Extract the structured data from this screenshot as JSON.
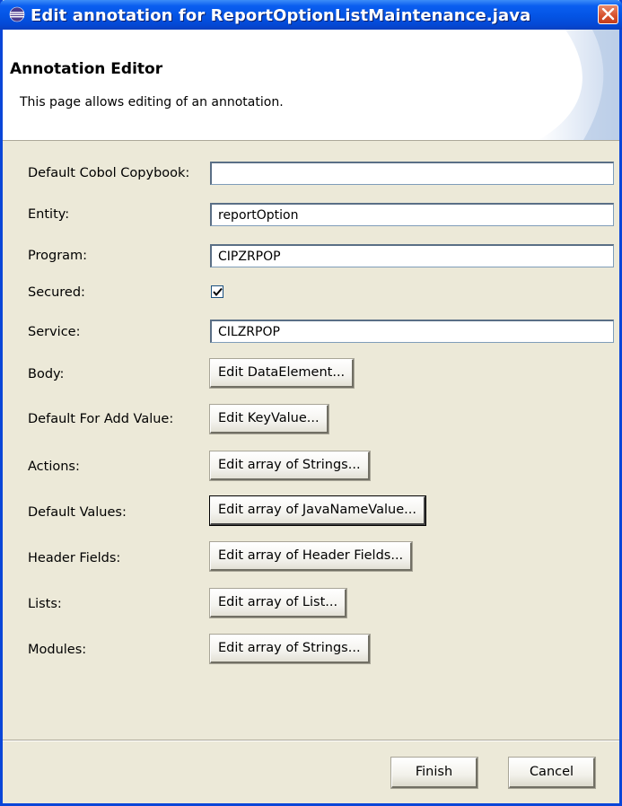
{
  "window": {
    "title": "Edit annotation for ReportOptionListMaintenance.java",
    "close_icon": "close-icon",
    "app_icon": "eclipse-icon"
  },
  "banner": {
    "title": "Annotation Editor",
    "description": "This page allows editing of an annotation."
  },
  "fields": {
    "default_cobol_copybook": {
      "label": "Default Cobol Copybook:",
      "value": ""
    },
    "entity": {
      "label": "Entity:",
      "value": "reportOption"
    },
    "program": {
      "label": "Program:",
      "value": "CIPZRPOP"
    },
    "secured": {
      "label": "Secured:",
      "checked": true
    },
    "service": {
      "label": "Service:",
      "value": "CILZRPOP"
    },
    "body": {
      "label": "Body:",
      "button": "Edit DataElement..."
    },
    "default_for_add_value": {
      "label": "Default For Add Value:",
      "button": "Edit KeyValue..."
    },
    "actions": {
      "label": "Actions:",
      "button": "Edit array of Strings..."
    },
    "default_values": {
      "label": "Default Values:",
      "button": "Edit array of JavaNameValue..."
    },
    "header_fields": {
      "label": "Header Fields:",
      "button": "Edit array of Header Fields..."
    },
    "lists": {
      "label": "Lists:",
      "button": "Edit array of List..."
    },
    "modules": {
      "label": "Modules:",
      "button": "Edit array of Strings..."
    }
  },
  "footer": {
    "finish_label": "Finish",
    "cancel_label": "Cancel"
  },
  "colors": {
    "titlebar": "#0454e4",
    "dialog_bg": "#ece9d8",
    "close_button": "#d64f2b"
  }
}
